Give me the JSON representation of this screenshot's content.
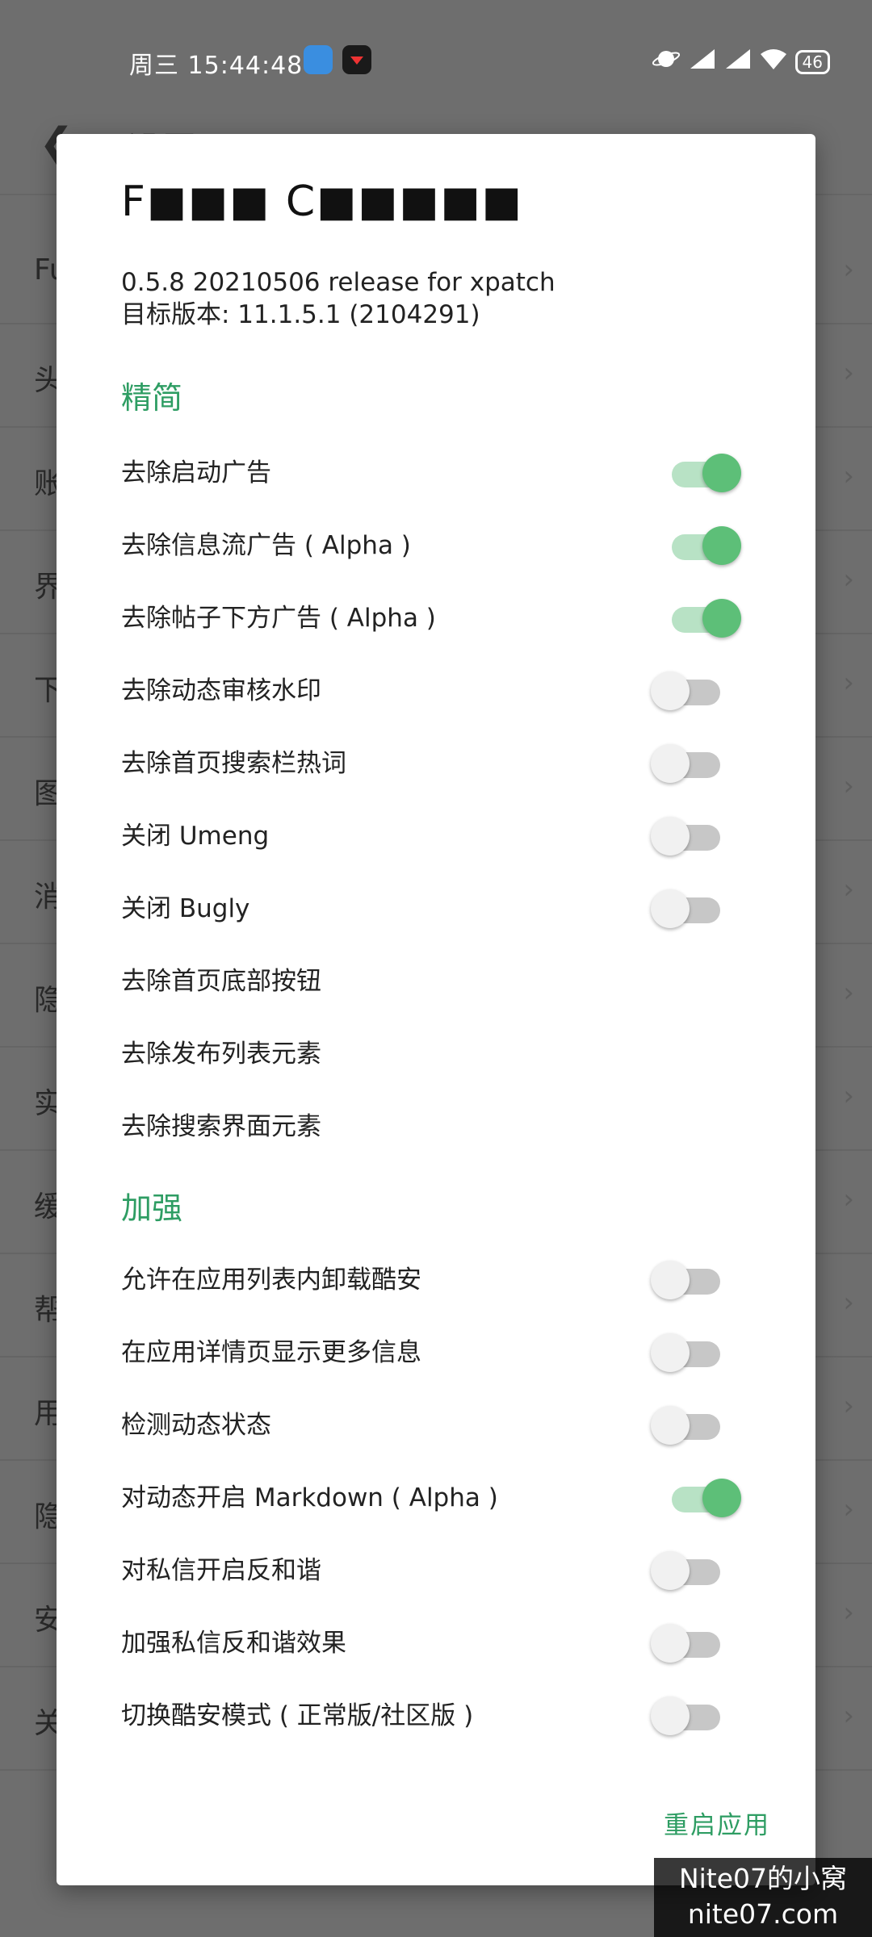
{
  "status_bar": {
    "time": "周三 15:44:48",
    "battery": "46"
  },
  "background": {
    "title": "设置",
    "items": [
      {
        "label": "Fu"
      },
      {
        "label": "头"
      },
      {
        "label": "账"
      },
      {
        "label": "界"
      },
      {
        "label": "下"
      },
      {
        "label": "图"
      },
      {
        "label": "消"
      },
      {
        "label": "隐"
      },
      {
        "label": "实"
      },
      {
        "label": "缓"
      },
      {
        "label": "帮"
      },
      {
        "label": "用"
      },
      {
        "label": "隐"
      },
      {
        "label": "安"
      },
      {
        "label": "关"
      }
    ]
  },
  "dialog": {
    "title": "F■■■ C■■■■■",
    "version_line1": "0.5.8 20210506 release  for xpatch",
    "version_line2": "目标版本: 11.1.5.1 (2104291)",
    "sections": {
      "simplify": "精简",
      "enhance": "加强"
    },
    "simplify_items": [
      {
        "label": "去除启动广告",
        "checked": true
      },
      {
        "label": "去除信息流广告 ( Alpha )",
        "checked": true
      },
      {
        "label": "去除帖子下方广告 ( Alpha )",
        "checked": true
      },
      {
        "label": "去除动态审核水印",
        "checked": false
      },
      {
        "label": "去除首页搜索栏热词",
        "checked": false
      },
      {
        "label": "关闭 Umeng",
        "checked": false
      },
      {
        "label": "关闭 Bugly",
        "checked": false
      },
      {
        "label": "去除首页底部按钮"
      },
      {
        "label": "去除发布列表元素"
      },
      {
        "label": "去除搜索界面元素"
      }
    ],
    "enhance_items": [
      {
        "label": "允许在应用列表内卸载酷安",
        "checked": false
      },
      {
        "label": "在应用详情页显示更多信息",
        "checked": false
      },
      {
        "label": "检测动态状态",
        "checked": false
      },
      {
        "label": "对动态开启 Markdown ( Alpha )",
        "checked": true
      },
      {
        "label": "对私信开启反和谐",
        "checked": false
      },
      {
        "label": "加强私信反和谐效果",
        "checked": false
      },
      {
        "label": "切换酷安模式 ( 正常版/社区版 )",
        "checked": false
      }
    ],
    "action": "重启应用"
  },
  "watermark": {
    "line1": "Nite07的小窝",
    "line2": "nite07.com"
  },
  "colors": {
    "accent": "#2e9d63",
    "switch_on": "#5dbf78",
    "overlay": "#6e6e6e"
  }
}
